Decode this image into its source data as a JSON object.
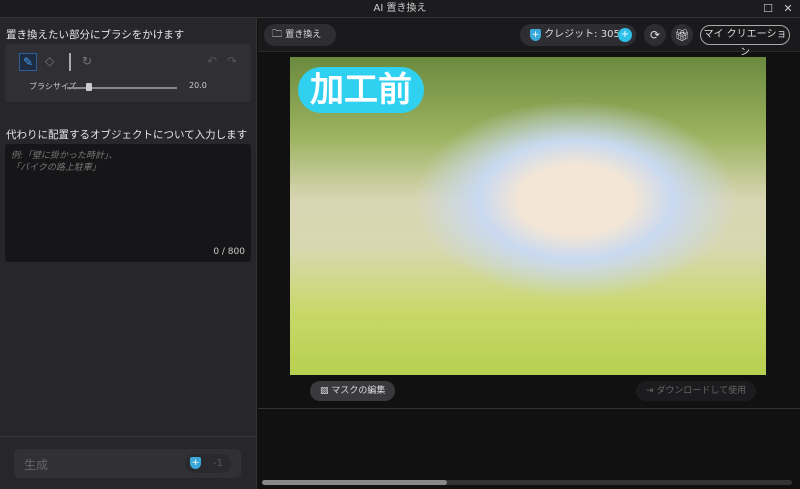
{
  "window": {
    "title": "AI 置き換え",
    "maximize_icon": "☐",
    "close_icon": "✕"
  },
  "left": {
    "brush_heading": "置き換えたい部分にブラシをかけます",
    "brush_size_label": "ブラシサイズ",
    "brush_size_value": "20.0",
    "brush_size_fraction": 0.2,
    "prompt_heading": "代わりに配置するオブジェクトについて入力します",
    "prompt_placeholder_1": "例:「壁に掛かった時計」、",
    "prompt_placeholder_2": "「バイクの路上駐車」",
    "char_count": "0 / 800",
    "generate_label": "生成",
    "generate_cost": "-1"
  },
  "toolbar": {
    "replace_label": "置き換え",
    "credits_label": "クレジット: 305",
    "my_creations_label": "マイ クリエーション"
  },
  "canvas": {
    "badge": "加工前",
    "edit_mask_label": "マスクの編集",
    "download_label": "ダウンロードして使用",
    "accent": "#2fd0f0"
  }
}
